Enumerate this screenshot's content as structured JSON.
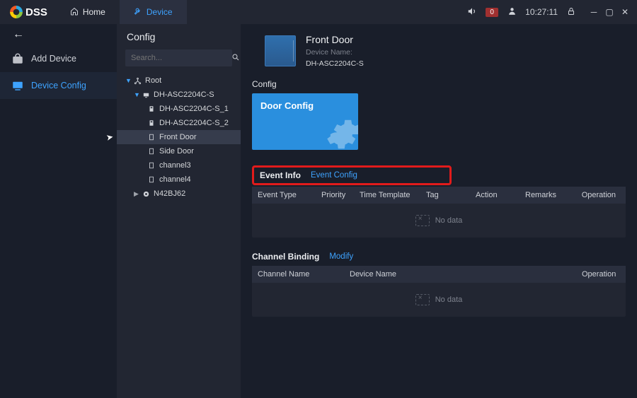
{
  "brand": "DSS",
  "topbar": {
    "home_label": "Home",
    "device_label": "Device",
    "notif_count": "0",
    "clock": "10:27:11"
  },
  "rail": {
    "add_device": "Add Device",
    "device_config": "Device Config"
  },
  "config_panel": {
    "title": "Config",
    "search_placeholder": "Search..."
  },
  "tree": {
    "root": "Root",
    "device": "DH-ASC2204C-S",
    "ch1": "DH-ASC2204C-S_1",
    "ch2": "DH-ASC2204C-S_2",
    "front": "Front Door",
    "side": "Side Door",
    "c3": "channel3",
    "c4": "channel4",
    "other": "N42BJ62"
  },
  "device_header": {
    "title": "Front Door",
    "subtitle": "Device Name:",
    "device_id": "DH-ASC2204C-S"
  },
  "sections": {
    "config_label": "Config",
    "tile_title": "Door Config",
    "event_info_title": "Event Info",
    "event_config_link": "Event Config",
    "channel_binding_title": "Channel Binding",
    "modify_link": "Modify"
  },
  "event_table": {
    "headers": {
      "event_type": "Event Type",
      "priority": "Priority",
      "time_template": "Time Template",
      "tag": "Tag",
      "action": "Action",
      "remarks": "Remarks",
      "operation": "Operation"
    },
    "nodata": "No data"
  },
  "channel_table": {
    "headers": {
      "channel_name": "Channel Name",
      "device_name": "Device Name",
      "operation": "Operation"
    },
    "nodata": "No data"
  }
}
